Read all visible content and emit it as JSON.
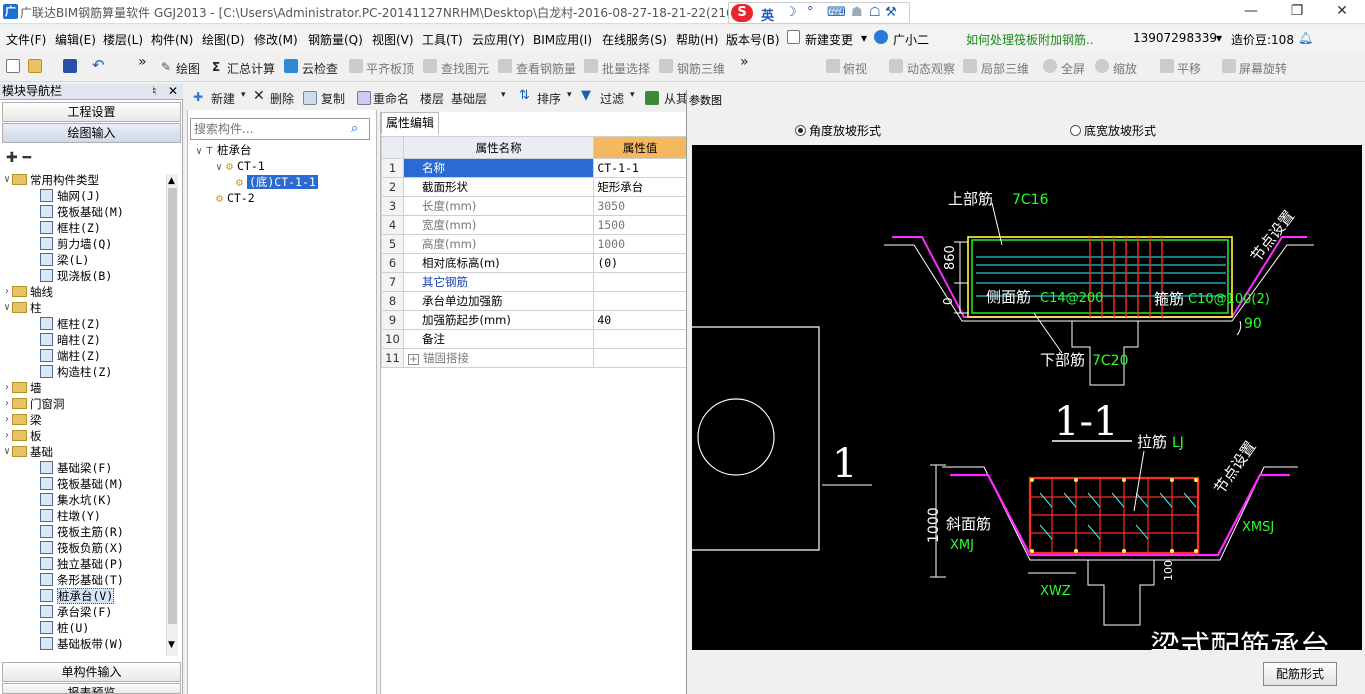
{
  "window": {
    "title": "广联达BIM钢筋算量软件 GGJ2013 - [C:\\Users\\Administrator.PC-20141127NRHM\\Desktop\\白龙村-2016-08-27-18-21-22(216",
    "app_icon": "广",
    "min": "—",
    "restore": "❐",
    "close": "✕"
  },
  "ime": {
    "logo": "S",
    "items": [
      "英",
      "☽",
      "°",
      "⌨",
      "☗",
      "☖",
      "✦",
      "⚒"
    ]
  },
  "menu": {
    "items": [
      "文件(F)",
      "编辑(E)",
      "楼层(L)",
      "构件(N)",
      "绘图(D)",
      "修改(M)",
      "钢筋量(Q)",
      "视图(V)",
      "工具(T)",
      "云应用(Y)",
      "BIM应用(I)",
      "在线服务(S)",
      "帮助(H)",
      "版本号(B)"
    ],
    "new_change": "新建变更",
    "assistant": "广小二",
    "question": "如何处理筏板附加钢筋..",
    "phone": "13907298339",
    "cost_beans": "造价豆:108"
  },
  "toolbar": {
    "draw": "绘图",
    "sum": "汇总计算",
    "cloud_check": "云检查",
    "flush_slab": "平齐板顶",
    "find_elem": "查找图元",
    "view_rebar": "查看钢筋量",
    "batch_select": "批量选择",
    "rebar_3d": "钢筋三维",
    "view_mode": "三维",
    "top_view": "俯视",
    "dyn_observe": "动态观察",
    "local_3d": "局部三维",
    "fullscreen": "全屏",
    "zoom": "缩放",
    "pan": "平移",
    "screen_rotate": "屏幕旋转"
  },
  "nav": {
    "header": "模块导航栏",
    "pin": "♮",
    "close": "✕",
    "project_settings": "工程设置",
    "draw_input": "绘图输入",
    "tree": [
      {
        "label": "常用构件类型",
        "level": 0,
        "kind": "folder",
        "expanded": true
      },
      {
        "label": "轴网(J)",
        "level": 1,
        "kind": "item"
      },
      {
        "label": "筏板基础(M)",
        "level": 1,
        "kind": "item"
      },
      {
        "label": "框柱(Z)",
        "level": 1,
        "kind": "item"
      },
      {
        "label": "剪力墙(Q)",
        "level": 1,
        "kind": "item"
      },
      {
        "label": "梁(L)",
        "level": 1,
        "kind": "item"
      },
      {
        "label": "现浇板(B)",
        "level": 1,
        "kind": "item"
      },
      {
        "label": "轴线",
        "level": 0,
        "kind": "folder",
        "expanded": false
      },
      {
        "label": "柱",
        "level": 0,
        "kind": "folder",
        "expanded": true
      },
      {
        "label": "框柱(Z)",
        "level": 1,
        "kind": "item"
      },
      {
        "label": "暗柱(Z)",
        "level": 1,
        "kind": "item"
      },
      {
        "label": "端柱(Z)",
        "level": 1,
        "kind": "item"
      },
      {
        "label": "构造柱(Z)",
        "level": 1,
        "kind": "item"
      },
      {
        "label": "墙",
        "level": 0,
        "kind": "folder",
        "expanded": false
      },
      {
        "label": "门窗洞",
        "level": 0,
        "kind": "folder",
        "expanded": false
      },
      {
        "label": "梁",
        "level": 0,
        "kind": "folder",
        "expanded": false
      },
      {
        "label": "板",
        "level": 0,
        "kind": "folder",
        "expanded": false
      },
      {
        "label": "基础",
        "level": 0,
        "kind": "folder",
        "expanded": true
      },
      {
        "label": "基础梁(F)",
        "level": 1,
        "kind": "item"
      },
      {
        "label": "筏板基础(M)",
        "level": 1,
        "kind": "item"
      },
      {
        "label": "集水坑(K)",
        "level": 1,
        "kind": "item"
      },
      {
        "label": "柱墩(Y)",
        "level": 1,
        "kind": "item"
      },
      {
        "label": "筏板主筋(R)",
        "level": 1,
        "kind": "item"
      },
      {
        "label": "筏板负筋(X)",
        "level": 1,
        "kind": "item"
      },
      {
        "label": "独立基础(P)",
        "level": 1,
        "kind": "item"
      },
      {
        "label": "条形基础(T)",
        "level": 1,
        "kind": "item"
      },
      {
        "label": "桩承台(V)",
        "level": 1,
        "kind": "item",
        "selected": true
      },
      {
        "label": "承台梁(F)",
        "level": 1,
        "kind": "item"
      },
      {
        "label": "桩(U)",
        "level": 1,
        "kind": "item"
      },
      {
        "label": "基础板带(W)",
        "level": 1,
        "kind": "item"
      }
    ],
    "single_input": "单构件输入",
    "report_preview": "报表预览"
  },
  "comp_toolbar": {
    "new": "新建",
    "delete": "删除",
    "copy": "复制",
    "rename": "重命名",
    "floor_label": "楼层",
    "floor_value": "基础层",
    "sort": "排序",
    "filter": "过滤",
    "from": "从其"
  },
  "comp": {
    "search_placeholder": "搜索构件...",
    "tree": [
      {
        "label": "桩承台",
        "level": 0
      },
      {
        "label": "CT-1",
        "level": 1
      },
      {
        "label": "(底)CT-1-1",
        "level": 2,
        "selected": true
      },
      {
        "label": "CT-2",
        "level": 1
      }
    ]
  },
  "props": {
    "tab": "属性编辑",
    "col_name": "属性名称",
    "col_value": "属性值",
    "rows": [
      {
        "n": "1",
        "name": "名称",
        "value": "CT-1-1",
        "style": "blue",
        "selected": true
      },
      {
        "n": "2",
        "name": "截面形状",
        "value": "矩形承台",
        "style": "normal"
      },
      {
        "n": "3",
        "name": "长度(mm)",
        "value": "3050",
        "style": "dim"
      },
      {
        "n": "4",
        "name": "宽度(mm)",
        "value": "1500",
        "style": "dim"
      },
      {
        "n": "5",
        "name": "高度(mm)",
        "value": "1000",
        "style": "dim"
      },
      {
        "n": "6",
        "name": "相对底标高(m)",
        "value": "(0)",
        "style": "normal"
      },
      {
        "n": "7",
        "name": "其它钢筋",
        "value": "",
        "style": "blue"
      },
      {
        "n": "8",
        "name": "承台单边加强筋",
        "value": "",
        "style": "normal"
      },
      {
        "n": "9",
        "name": "加强筋起步(mm)",
        "value": "40",
        "style": "normal"
      },
      {
        "n": "10",
        "name": "备注",
        "value": "",
        "style": "normal"
      },
      {
        "n": "11",
        "name": "锚固搭接",
        "value": "",
        "style": "dim",
        "expand": "+"
      }
    ]
  },
  "param": {
    "title": "参数图",
    "radio_angle": "角度放坡形式",
    "radio_width": "底宽放坡形式",
    "button": "配筋形式",
    "cad": {
      "top_bar_label": "上部筋",
      "top_bar_value": "7C16",
      "node_setting": "节点设置",
      "dim_860": "860",
      "dim_0": "0",
      "side_bar_label": "侧面筋",
      "side_bar_value": "C14@200",
      "stirrup_label": "箍筋",
      "stirrup_value": "C10@100(2)",
      "angle": "90",
      "bottom_bar_label": "下部筋",
      "bottom_bar_value": "7C20",
      "section": "1-1",
      "left_number": "1",
      "tie_label": "拉筋",
      "tie_value": "LJ",
      "node_setting2": "节点设置",
      "dim_1000": "1000",
      "slope_label": "斜面筋",
      "slope_left": "XMJ",
      "slope_right": "XMSJ",
      "bottom_width": "XWZ",
      "dim_100": "100",
      "caption": "梁式配筋承台"
    }
  }
}
